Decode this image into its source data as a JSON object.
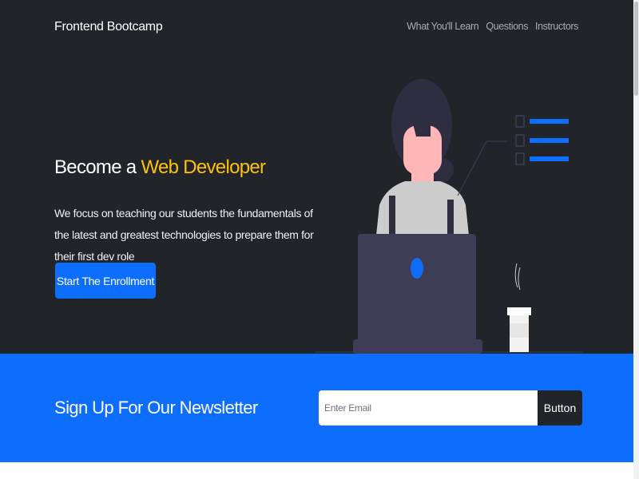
{
  "navbar": {
    "brand": "Frontend Bootcamp",
    "links": [
      {
        "label": "What You'll Learn"
      },
      {
        "label": "Questions"
      },
      {
        "label": "Instructors"
      }
    ]
  },
  "hero": {
    "title_prefix": "Become a ",
    "title_highlight": "Web Developer",
    "description": "We focus on teaching our students the fundamentals of the latest and greatest technologies to prepare them for their first dev role",
    "cta_label": "Start The Enrollment",
    "illustration_icon": "developer-at-laptop-illustration"
  },
  "newsletter": {
    "title": "Sign Up For Our Newsletter",
    "email_placeholder": "Enter Email",
    "button_label": "Button"
  },
  "colors": {
    "dark_bg": "#212529",
    "primary": "#0d6efd",
    "accent": "#ffc107",
    "white": "#ffffff"
  }
}
